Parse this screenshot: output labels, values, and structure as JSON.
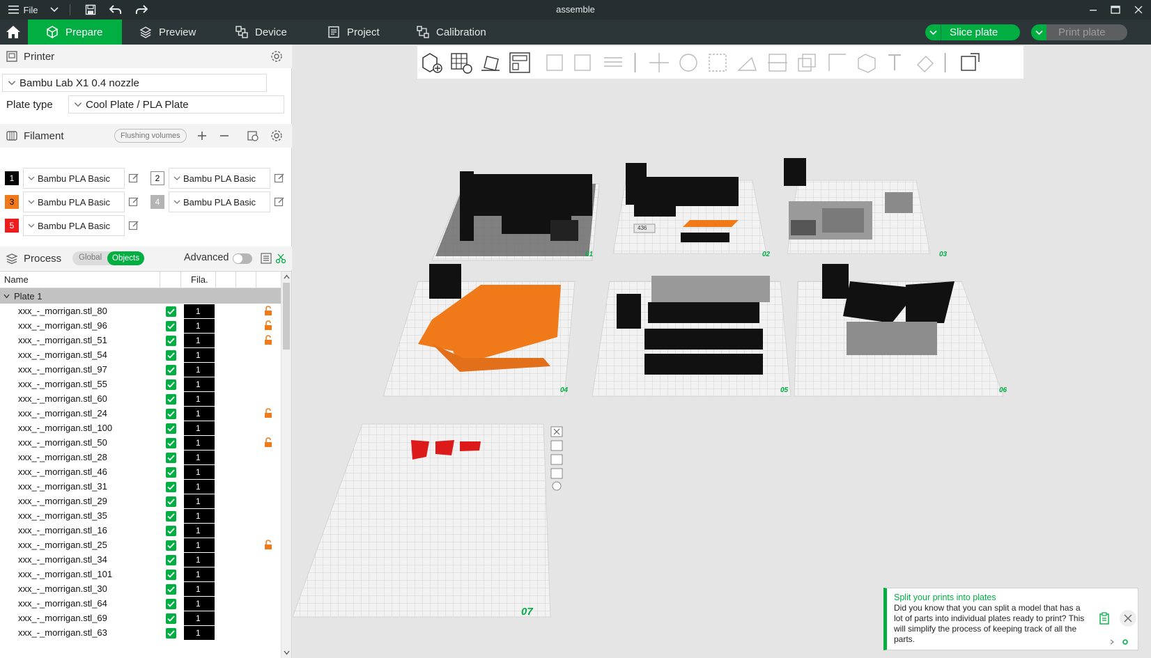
{
  "titlebar": {
    "file_label": "File",
    "title": "assemble"
  },
  "tabs": [
    {
      "label": "Prepare",
      "icon": "cube-icon"
    },
    {
      "label": "Preview",
      "icon": "layers-icon"
    },
    {
      "label": "Device",
      "icon": "device-icon"
    },
    {
      "label": "Project",
      "icon": "project-icon"
    },
    {
      "label": "Calibration",
      "icon": "calibration-icon"
    }
  ],
  "actions": {
    "slice": "Slice plate",
    "print": "Print plate"
  },
  "printer": {
    "section_label": "Printer",
    "selected": "Bambu Lab X1 0.4 nozzle",
    "plate_type_label": "Plate type",
    "plate_type_value": "Cool Plate / PLA Plate"
  },
  "filament": {
    "section_label": "Filament",
    "flushing_label": "Flushing volumes",
    "items": [
      {
        "num": "1",
        "name": "Bambu PLA Basic",
        "color": "#000000",
        "text_color": "#ffffff"
      },
      {
        "num": "2",
        "name": "Bambu PLA Basic",
        "color": "#ffffff",
        "text_color": "#000000"
      },
      {
        "num": "3",
        "name": "Bambu PLA Basic",
        "color": "#f07a1a",
        "text_color": "#000000"
      },
      {
        "num": "4",
        "name": "Bambu PLA Basic",
        "color": "#b4b4b4",
        "text_color": "#ffffff"
      },
      {
        "num": "5",
        "name": "Bambu PLA Basic",
        "color": "#ee1c1c",
        "text_color": "#ffffff"
      }
    ]
  },
  "process": {
    "section_label": "Process",
    "global_label": "Global",
    "objects_label": "Objects",
    "advanced_label": "Advanced"
  },
  "table": {
    "col_name": "Name",
    "col_fila": "Fila.",
    "plate_label": "Plate 1",
    "rows": [
      {
        "name": "xxx_-_morrigan.stl_80",
        "fila": "1",
        "locked": true
      },
      {
        "name": "xxx_-_morrigan.stl_96",
        "fila": "1",
        "locked": true
      },
      {
        "name": "xxx_-_morrigan.stl_51",
        "fila": "1",
        "locked": true
      },
      {
        "name": "xxx_-_morrigan.stl_54",
        "fila": "1",
        "locked": false
      },
      {
        "name": "xxx_-_morrigan.stl_97",
        "fila": "1",
        "locked": false
      },
      {
        "name": "xxx_-_morrigan.stl_55",
        "fila": "1",
        "locked": false
      },
      {
        "name": "xxx_-_morrigan.stl_60",
        "fila": "1",
        "locked": false
      },
      {
        "name": "xxx_-_morrigan.stl_24",
        "fila": "1",
        "locked": true
      },
      {
        "name": "xxx_-_morrigan.stl_100",
        "fila": "1",
        "locked": false
      },
      {
        "name": "xxx_-_morrigan.stl_50",
        "fila": "1",
        "locked": true
      },
      {
        "name": "xxx_-_morrigan.stl_28",
        "fila": "1",
        "locked": false
      },
      {
        "name": "xxx_-_morrigan.stl_46",
        "fila": "1",
        "locked": false
      },
      {
        "name": "xxx_-_morrigan.stl_31",
        "fila": "1",
        "locked": false
      },
      {
        "name": "xxx_-_morrigan.stl_29",
        "fila": "1",
        "locked": false
      },
      {
        "name": "xxx_-_morrigan.stl_35",
        "fila": "1",
        "locked": false
      },
      {
        "name": "xxx_-_morrigan.stl_16",
        "fila": "1",
        "locked": false
      },
      {
        "name": "xxx_-_morrigan.stl_25",
        "fila": "1",
        "locked": true
      },
      {
        "name": "xxx_-_morrigan.stl_34",
        "fila": "1",
        "locked": false
      },
      {
        "name": "xxx_-_morrigan.stl_101",
        "fila": "1",
        "locked": false
      },
      {
        "name": "xxx_-_morrigan.stl_30",
        "fila": "1",
        "locked": false
      },
      {
        "name": "xxx_-_morrigan.stl_64",
        "fila": "1",
        "locked": false
      },
      {
        "name": "xxx_-_morrigan.stl_69",
        "fila": "1",
        "locked": false
      },
      {
        "name": "xxx_-_morrigan.stl_63",
        "fila": "1",
        "locked": false
      }
    ]
  },
  "viewport": {
    "plates": [
      "01",
      "02",
      "03",
      "04",
      "05",
      "06",
      "07"
    ],
    "model_label": "436"
  },
  "tip": {
    "title": "Split your prints into plates",
    "body": "Did you know that you can split a model that has a lot of parts into individual plates ready to print? This will simplify the process of keeping track of all the parts."
  },
  "colors": {
    "accent": "#00ae42",
    "dark_bar": "#262e30",
    "tab_bar": "#2c3537",
    "orange": "#f07a1a"
  }
}
